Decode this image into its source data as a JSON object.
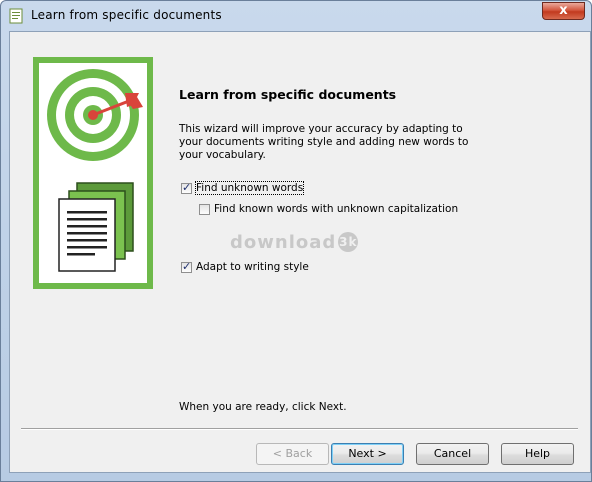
{
  "window": {
    "title": "Learn from specific documents",
    "close_glyph": "x"
  },
  "main": {
    "heading": "Learn from specific documents",
    "intro": "This wizard will improve your accuracy by adapting to your documents writing style and adding new words to your vocabulary.",
    "options": [
      {
        "label": "Find unknown words",
        "checked": true
      },
      {
        "label": "Find known words with unknown capitalization",
        "checked": false
      },
      {
        "label": "Adapt to writing style",
        "checked": true
      }
    ],
    "ready_text": "When you are ready, click Next."
  },
  "watermark": {
    "text": "download",
    "badge": "3k"
  },
  "buttons": {
    "back": "< Back",
    "next": "Next >",
    "cancel": "Cancel",
    "help": "Help"
  },
  "colors": {
    "graphic_green": "#6eb94a",
    "target_dart": "#d9443b"
  },
  "icons": [
    "app-document-icon",
    "target-illustration",
    "documents-stack-illustration"
  ]
}
